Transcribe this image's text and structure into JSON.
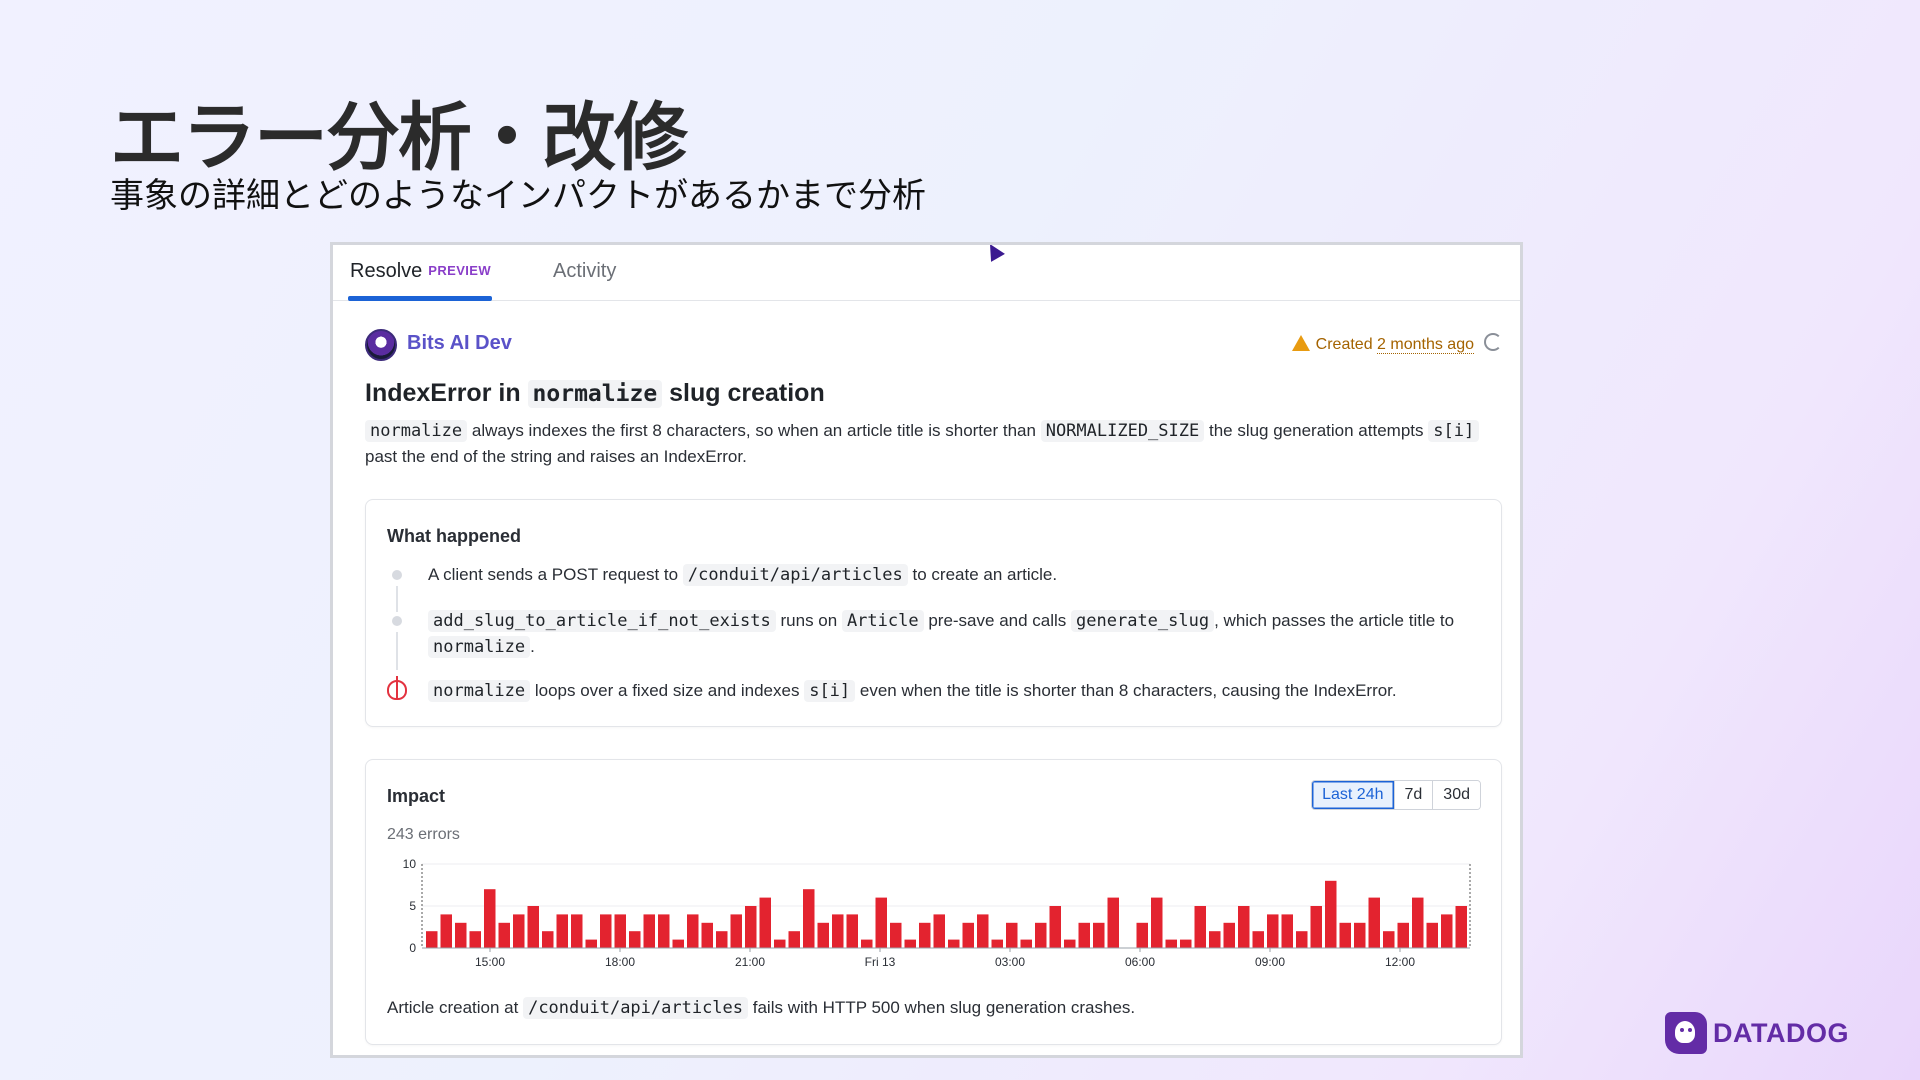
{
  "slide": {
    "title": "エラー分析・改修",
    "subtitle": "事象の詳細とどのようなインパクトがあるかまで分析"
  },
  "tabs": [
    {
      "label": "Resolve",
      "badge": "PREVIEW",
      "active": true
    },
    {
      "label": "Activity",
      "active": false
    }
  ],
  "author": {
    "name": "Bits AI Dev"
  },
  "created": {
    "prefix": "Created",
    "time": "2 months ago"
  },
  "issue": {
    "title_pre": "IndexError in",
    "title_code": "normalize",
    "title_post": "slug creation",
    "desc": {
      "code1": "normalize",
      "text1": "always indexes the first 8 characters, so when an article title is shorter than",
      "code2": "NORMALIZED_SIZE",
      "text2": "the slug generation attempts",
      "code3": "s[i]",
      "text3": "past the end of the string and raises an IndexError."
    }
  },
  "what_happened": {
    "title": "What happened",
    "step1": {
      "text1": "A client sends a POST request to",
      "code1": "/conduit/api/articles",
      "text2": "to create an article."
    },
    "step2": {
      "code1": "add_slug_to_article_if_not_exists",
      "text1": "runs on",
      "code2": "Article",
      "text2": "pre-save and calls",
      "code3": "generate_slug",
      "text3": ", which passes the article title to",
      "code4": "normalize",
      "text4": "."
    },
    "step3": {
      "code1": "normalize",
      "text1": "loops over a fixed size and indexes",
      "code2": "s[i]",
      "text2": "even when the title is shorter than 8 characters, causing the IndexError."
    }
  },
  "impact": {
    "title": "Impact",
    "ranges": [
      "Last 24h",
      "7d",
      "30d"
    ],
    "active_range": "Last 24h",
    "errors": "243 errors",
    "note": {
      "text1": "Article creation at",
      "code1": "/conduit/api/articles",
      "text2": "fails with HTTP 500 when slug generation crashes."
    }
  },
  "chart_data": {
    "type": "bar",
    "ylim": [
      0,
      10
    ],
    "y_ticks": [
      "0",
      "5",
      "10"
    ],
    "x_ticks": [
      "15:00",
      "18:00",
      "21:00",
      "Fri 13",
      "03:00",
      "06:00",
      "09:00",
      "12:00"
    ],
    "values": [
      2,
      4,
      3,
      2,
      7,
      3,
      4,
      5,
      2,
      4,
      4,
      1,
      4,
      4,
      2,
      4,
      4,
      1,
      4,
      3,
      2,
      4,
      5,
      6,
      1,
      2,
      7,
      3,
      4,
      4,
      1,
      6,
      3,
      1,
      3,
      4,
      1,
      3,
      4,
      1,
      3,
      1,
      3,
      5,
      1,
      3,
      3,
      6,
      0,
      3,
      6,
      1,
      1,
      5,
      2,
      3,
      5,
      2,
      4,
      4,
      2,
      5,
      8,
      3,
      3,
      6,
      2,
      3,
      6,
      3,
      4,
      5
    ],
    "color": "#e3232f"
  },
  "brand": {
    "logo_text": "DATADOG",
    "accent": "#632ca6"
  }
}
